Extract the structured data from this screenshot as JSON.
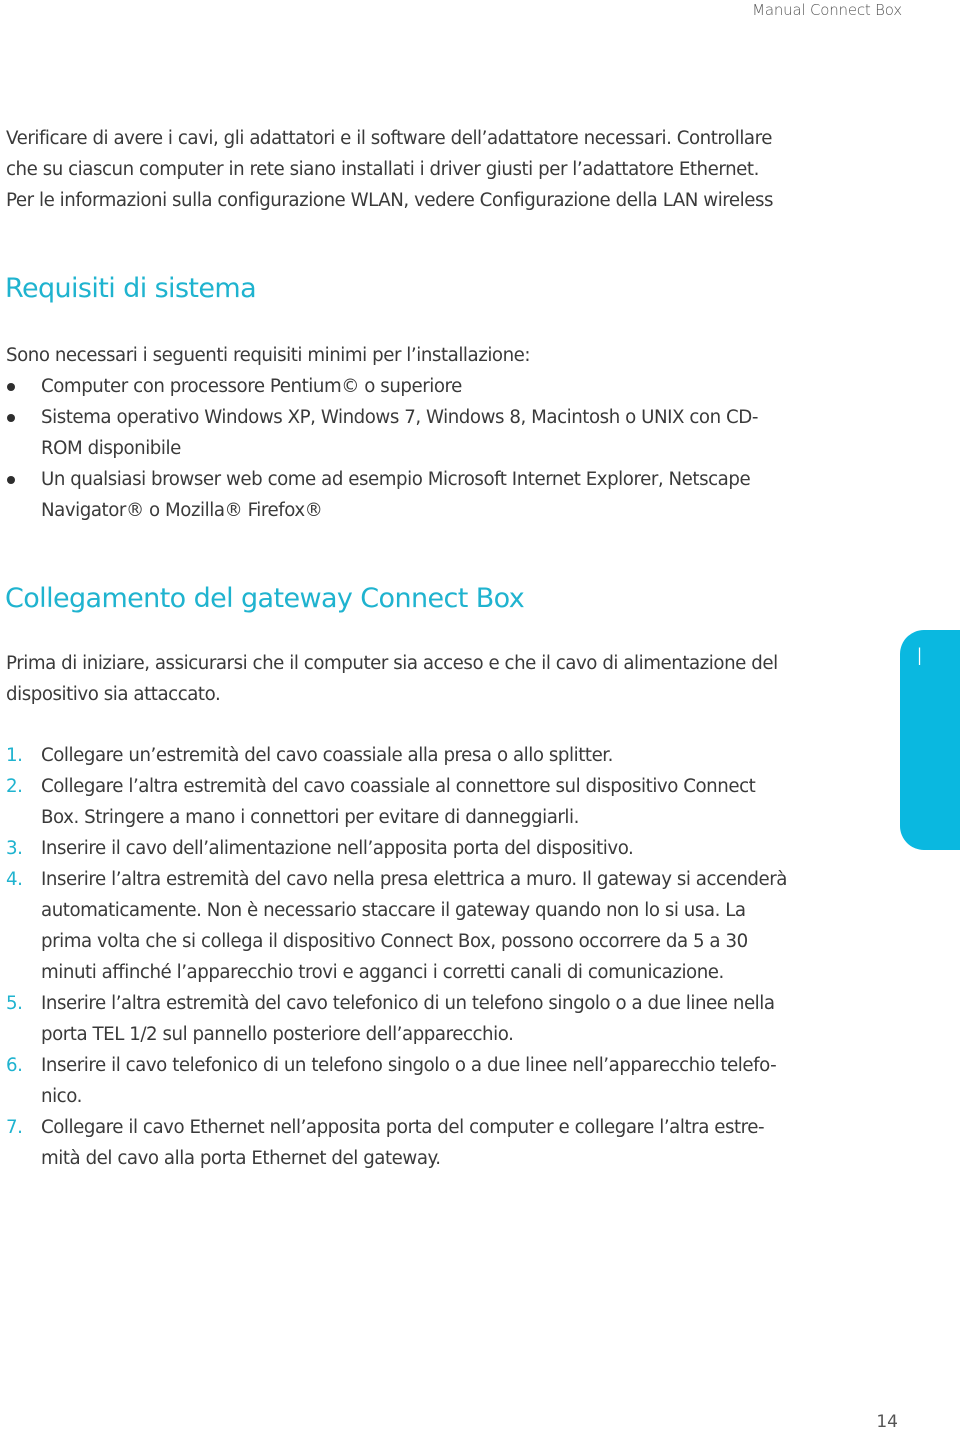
{
  "header": {
    "title": "Manual Connect Box"
  },
  "intro": {
    "lines": [
      "Verificare di avere i cavi, gli adattatori e il software dell’adattatore necessari. Controllare",
      "che su ciascun computer in rete siano installati i driver giusti per l’adattatore Ethernet.",
      "Per le informazioni sulla configurazione WLAN, vedere Configurazione della LAN wireless"
    ]
  },
  "requirements": {
    "heading": "Requisiti di sistema",
    "lead": "Sono necessari i seguenti requisiti minimi per l’installazione:",
    "items": [
      {
        "lines": [
          "Computer con processore Pentium© o superiore"
        ]
      },
      {
        "lines": [
          "Sistema operativo Windows XP, Windows 7, Windows 8, Macintosh o UNIX con CD-",
          "ROM disponibile"
        ]
      },
      {
        "lines": [
          "Un qualsiasi browser web come ad esempio Microsoft Internet Explorer, Netscape",
          "Navigator® o Mozilla® Firefox®"
        ]
      }
    ]
  },
  "connection": {
    "heading": "Collegamento del gateway Connect Box",
    "intro_lines": [
      "Prima di iniziare, assicurarsi che il computer sia acceso e che il cavo di alimentazione del",
      "dispositivo sia attaccato."
    ],
    "steps": [
      {
        "num": "1.",
        "lines": [
          "Collegare un’estremità del cavo coassiale alla presa o allo splitter."
        ]
      },
      {
        "num": "2.",
        "lines": [
          "Collegare l’altra estremità del cavo coassiale al connettore sul dispositivo Connect",
          "Box. Stringere a mano i connettori per evitare di danneggiarli."
        ]
      },
      {
        "num": "3.",
        "lines": [
          "Inserire il cavo dell’alimentazione nell’apposita porta del dispositivo."
        ]
      },
      {
        "num": "4.",
        "lines": [
          "Inserire l’altra estremità del cavo nella presa elettrica a muro. Il gateway si accenderà",
          "automaticamente. Non è necessario staccare il gateway quando non lo si usa. La",
          "prima volta che si collega il dispositivo Connect Box, possono occorrere da 5 a 30",
          "minuti affinché l’apparecchio trovi e agganci i corretti canali di comunicazione."
        ]
      },
      {
        "num": "5.",
        "lines": [
          "Inserire l’altra estremità del cavo telefonico di un telefono singolo o a due linee nella",
          "porta TEL 1/2 sul pannello posteriore dell’apparecchio."
        ]
      },
      {
        "num": "6.",
        "lines": [
          "Inserire il cavo telefonico di un telefono singolo o a due linee nell’apparecchio telefo-",
          "nico."
        ]
      },
      {
        "num": "7.",
        "lines": [
          "Collegare il cavo Ethernet nell’apposita porta del computer e collegare l’altra estre-",
          "mità del cavo alla porta Ethernet del gateway."
        ]
      }
    ]
  },
  "chapter_tab": {
    "label": "I",
    "color": "#0ab8e0"
  },
  "accent_color": "#1fb3cf",
  "page_number": "14"
}
